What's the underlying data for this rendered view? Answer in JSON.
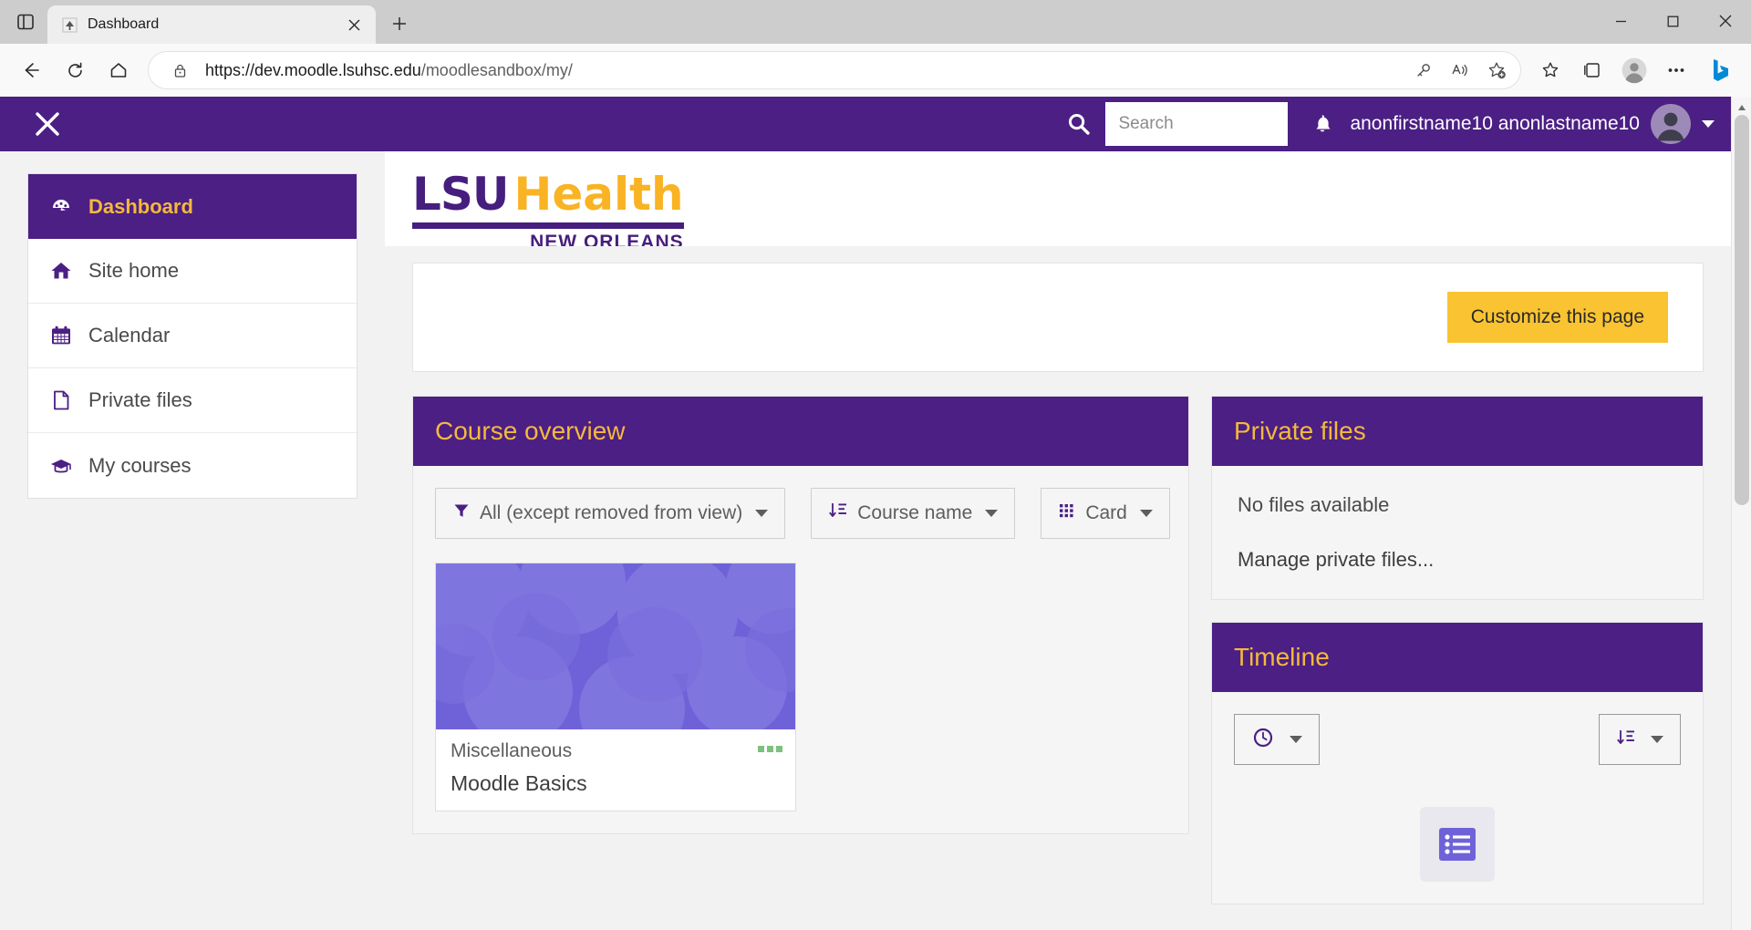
{
  "browser": {
    "tab": {
      "title": "Dashboard",
      "favicon_icon": "moodle-favicon",
      "close_icon": "close-icon"
    },
    "tab_list_icon": "tab-list-icon",
    "new_tab_icon": "plus-icon",
    "window": {
      "minimize_icon": "minimize-icon",
      "maximize_icon": "maximize-icon",
      "close_icon": "window-close-icon"
    },
    "nav": {
      "back_icon": "back-arrow-icon",
      "refresh_icon": "refresh-icon",
      "home_icon": "home-icon"
    },
    "omnibox": {
      "lock_icon": "lock-icon",
      "url_prefix": "https://dev.moodle.lsuhsc.edu",
      "url_suffix": "/moodlesandbox/my/",
      "key_icon": "key-icon",
      "read_aloud_icon": "read-aloud-icon",
      "favorite_icon": "add-favorite-icon"
    },
    "toolbar_right": {
      "collections_icon": "collections-icon",
      "favorites_icon": "favorites-icon",
      "profile_icon": "profile-avatar-icon",
      "settings_icon": "settings-more-icon",
      "copilot_icon": "bing-copilot-icon"
    }
  },
  "moodle": {
    "navbar": {
      "close_drawer_icon": "close-x-icon",
      "search_icon": "search-icon",
      "search_placeholder": "Search",
      "search_value": "",
      "notifications_icon": "bell-icon",
      "user_name": "anonfirstname10 anonlastname10",
      "user_avatar_icon": "user-avatar-icon",
      "user_caret_icon": "chevron-down-icon"
    },
    "drawer": {
      "items": [
        {
          "label": "Dashboard",
          "icon": "dashboard-speedometer-icon",
          "active": true
        },
        {
          "label": "Site home",
          "icon": "home-icon",
          "active": false
        },
        {
          "label": "Calendar",
          "icon": "calendar-icon",
          "active": false
        },
        {
          "label": "Private files",
          "icon": "file-icon",
          "active": false
        },
        {
          "label": "My courses",
          "icon": "graduation-cap-icon",
          "active": false
        }
      ]
    },
    "logo": {
      "lsu": "LSU",
      "health": "Health",
      "subtitle": "NEW ORLEANS"
    },
    "customize_button": "Customize this page",
    "course_overview": {
      "title": "Course overview",
      "filter_dropdown": {
        "label": "All (except removed from view)",
        "icon": "filter-icon"
      },
      "sort_dropdown": {
        "label": "Course name",
        "icon": "sort-icon"
      },
      "view_dropdown": {
        "label": "Card",
        "icon": "grid-icon"
      },
      "courses": [
        {
          "category": "Miscellaneous",
          "name": "Moodle Basics",
          "menu_icon": "kebab-menu-icon"
        }
      ]
    },
    "private_files": {
      "title": "Private files",
      "empty_text": "No files available",
      "manage_link": "Manage private files..."
    },
    "timeline": {
      "title": "Timeline",
      "date_filter_icon": "clock-icon",
      "sort_icon": "sort-icon",
      "placeholder_icon": "list-placeholder-icon"
    }
  },
  "colors": {
    "moodle_purple": "#4b1f84",
    "moodle_gold": "#f4b93d",
    "lsu_purple": "#461e7d",
    "lsu_gold": "#f9b323",
    "customize_yellow": "#f9c332"
  }
}
